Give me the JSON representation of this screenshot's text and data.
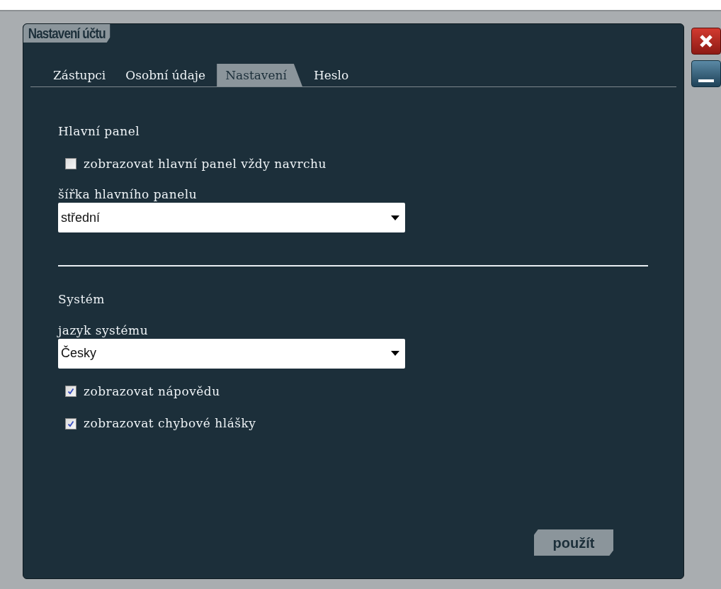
{
  "window": {
    "title": "Nastavení účtu"
  },
  "tabs": [
    {
      "label": "Zástupci",
      "selected": false
    },
    {
      "label": "Osobní údaje",
      "selected": false
    },
    {
      "label": "Nastavení",
      "selected": true
    },
    {
      "label": "Heslo",
      "selected": false
    }
  ],
  "sections": [
    {
      "heading": "Hlavní panel",
      "items": [
        {
          "kind": "checkbox",
          "label": "zobrazovat hlavní panel vždy navrchu",
          "checked": false
        },
        {
          "kind": "select",
          "label": "šířka hlavního panelu",
          "value": "střední"
        }
      ]
    },
    {
      "heading": "Systém",
      "items": [
        {
          "kind": "select",
          "label": "jazyk systému",
          "value": "Česky"
        },
        {
          "kind": "checkbox",
          "label": "zobrazovat nápovědu",
          "checked": true
        },
        {
          "kind": "checkbox",
          "label": "zobrazovat chybové hlášky",
          "checked": true
        }
      ]
    }
  ],
  "apply_button": "použít"
}
